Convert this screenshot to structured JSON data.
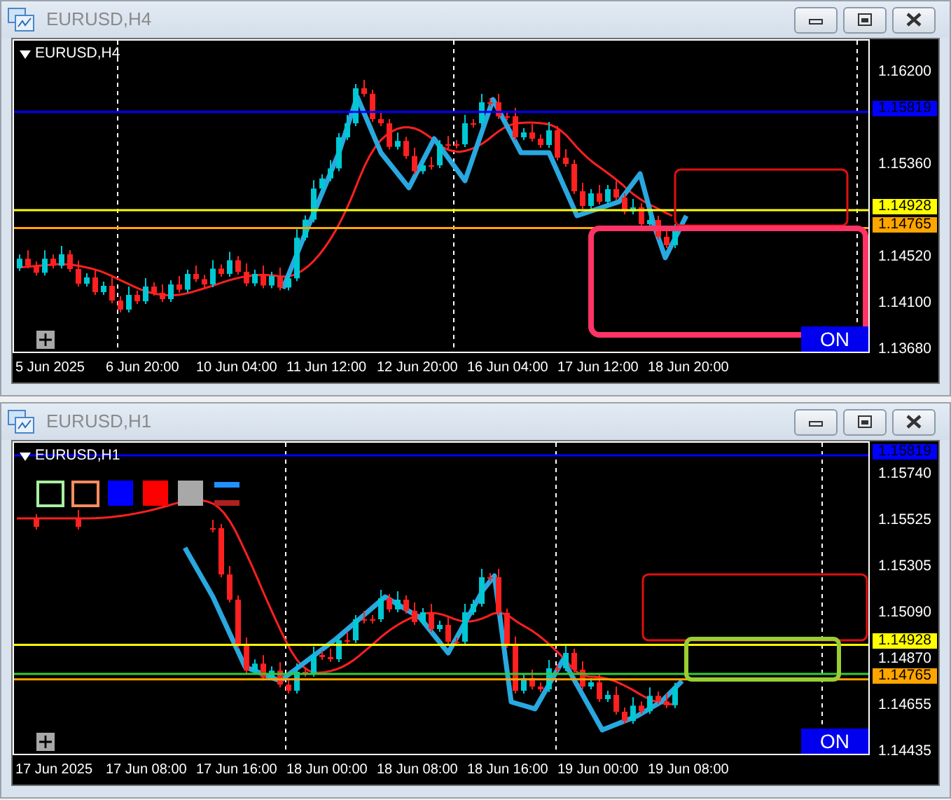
{
  "windows": [
    {
      "title": "EURUSD,H4",
      "chart_label": "EURUSD,H4",
      "price_ticks": [
        "1.16200",
        "1.15360",
        "1.14520",
        "1.14100",
        "1.13680"
      ],
      "price_levels": [
        {
          "price": "1.15819",
          "color": "#0000ff"
        },
        {
          "price": "1.14928",
          "color": "#ffff00"
        },
        {
          "price": "1.14765",
          "color": "#ffa500"
        }
      ],
      "time_labels": [
        "5 Jun 2025",
        "6 Jun 20:00",
        "10 Jun 04:00",
        "11 Jun 12:00",
        "12 Jun 20:00",
        "16 Jun 04:00",
        "17 Jun 12:00",
        "18 Jun 20:00"
      ],
      "button": "ON"
    },
    {
      "title": "EURUSD,H1",
      "chart_label": "EURUSD,H1",
      "price_ticks": [
        "1.15740",
        "1.15525",
        "1.15305",
        "1.15090",
        "1.14870",
        "1.14655",
        "1.14435"
      ],
      "price_levels": [
        {
          "price": "1.15819",
          "color": "#0000ff"
        },
        {
          "price": "1.14928",
          "color": "#ffff00"
        },
        {
          "price": "1.14765",
          "color": "#ffa500"
        }
      ],
      "time_labels": [
        "17 Jun 2025",
        "17 Jun 08:00",
        "17 Jun 16:00",
        "18 Jun 00:00",
        "18 Jun 08:00",
        "18 Jun 16:00",
        "19 Jun 00:00",
        "19 Jun 08:00"
      ],
      "button": "ON"
    }
  ]
}
